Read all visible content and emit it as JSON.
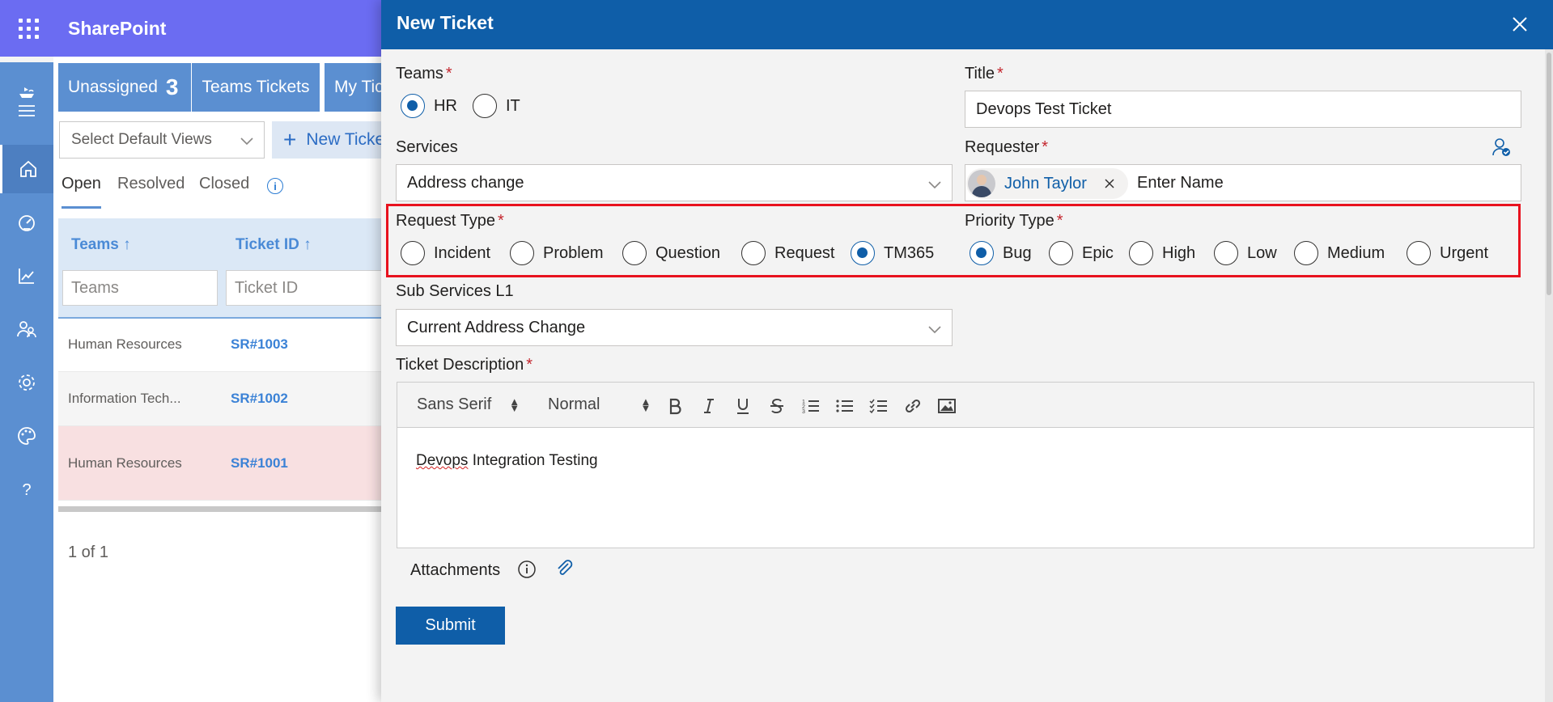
{
  "suite": {
    "title": "SharePoint"
  },
  "background": {
    "tabs": {
      "unassigned_label": "Unassigned",
      "unassigned_count": "3",
      "teams_label": "Teams Tickets",
      "my_label": "My Tickets"
    },
    "views_select": {
      "value": "Select Default Views"
    },
    "new_ticket_label": "New Ticket",
    "pivots": [
      "Open",
      "Resolved",
      "Closed"
    ],
    "grid": {
      "headers": [
        "Teams",
        "Ticket ID"
      ],
      "filter_placeholders": [
        "Teams",
        "Ticket ID"
      ],
      "rows": [
        {
          "team": "Human Resources",
          "id": "SR#1003"
        },
        {
          "team": "Information Tech...",
          "id": "SR#1002"
        },
        {
          "team": "Human Resources",
          "id": "SR#1001"
        }
      ]
    },
    "pager": "1 of 1"
  },
  "panel": {
    "title": "New Ticket",
    "teams": {
      "label": "Teams",
      "options": [
        "HR",
        "IT"
      ],
      "selected": "HR"
    },
    "title_field": {
      "label": "Title",
      "value": "Devops Test Ticket"
    },
    "services": {
      "label": "Services",
      "value": "Address change"
    },
    "requester": {
      "label": "Requester",
      "person": "John Taylor",
      "placeholder": "Enter Name"
    },
    "request_type": {
      "label": "Request Type",
      "options": [
        "Incident",
        "Problem",
        "Question",
        "Request",
        "TM365"
      ],
      "selected": "TM365"
    },
    "priority_type": {
      "label": "Priority Type",
      "options": [
        "Bug",
        "Epic",
        "High",
        "Low",
        "Medium",
        "Urgent"
      ],
      "selected": "Bug"
    },
    "sub_services": {
      "label": "Sub Services L1",
      "value": "Current Address Change"
    },
    "description": {
      "label": "Ticket Description",
      "font": "Sans Serif",
      "size": "Normal",
      "text_word1": "Devops",
      "text_rest": " Integration Testing"
    },
    "attachments": {
      "label": "Attachments"
    },
    "submit": "Submit"
  },
  "colors": {
    "suite_bar": "#6b6cf2",
    "rail": "#5b8fd1",
    "panel_header": "#0f5ea8",
    "highlight": "#e8121e"
  }
}
